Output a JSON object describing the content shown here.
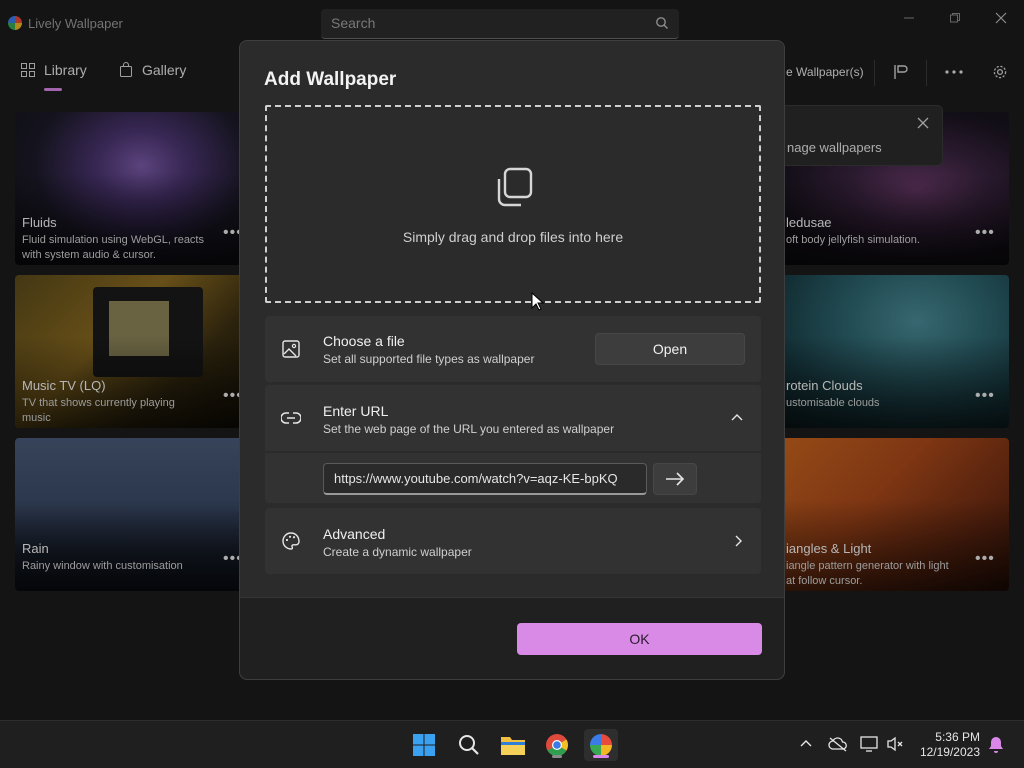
{
  "app": {
    "title": "Lively Wallpaper"
  },
  "search": {
    "placeholder": "Search"
  },
  "nav": {
    "library": "Library",
    "gallery": "Gallery"
  },
  "toolbar": {
    "wallpapers_label": "e Wallpaper(s)"
  },
  "tooltip": {
    "text": "nage wallpapers"
  },
  "cards": [
    {
      "title": "Fluids",
      "desc_line1": "Fluid simulation using WebGL, reacts",
      "desc_line2": "with system audio & cursor."
    },
    {
      "title": "Music TV (LQ)",
      "desc_line1": "TV that shows currently playing",
      "desc_line2": "music"
    },
    {
      "title": "Rain",
      "desc_line1": "Rainy window with customisation",
      "desc_line2": ""
    },
    {
      "title": "ledusae",
      "desc_line1": "oft body jellyfish simulation.",
      "desc_line2": ""
    },
    {
      "title": "rotein Clouds",
      "desc_line1": "ustomisable clouds",
      "desc_line2": ""
    },
    {
      "title": "iangles & Light",
      "desc_line1": "iangle pattern generator with light",
      "desc_line2": "at follow cursor."
    }
  ],
  "dialog": {
    "title": "Add Wallpaper",
    "drop_text": "Simply drag and drop files into here",
    "choose_file": {
      "title": "Choose a file",
      "subtitle": "Set all supported file types as wallpaper",
      "button": "Open"
    },
    "enter_url": {
      "title": "Enter URL",
      "subtitle": "Set the web page of the URL you entered as wallpaper",
      "value": "https://www.youtube.com/watch?v=aqz-KE-bpKQ"
    },
    "advanced": {
      "title": "Advanced",
      "subtitle": "Create a dynamic wallpaper"
    },
    "ok": "OK"
  },
  "taskbar": {
    "time": "5:36 PM",
    "date": "12/19/2023"
  },
  "colors": {
    "accent": "#d98ae6",
    "dialog_bg": "#2b2b2b",
    "row_bg": "#323232",
    "app_bg": "#1b1b1b"
  }
}
